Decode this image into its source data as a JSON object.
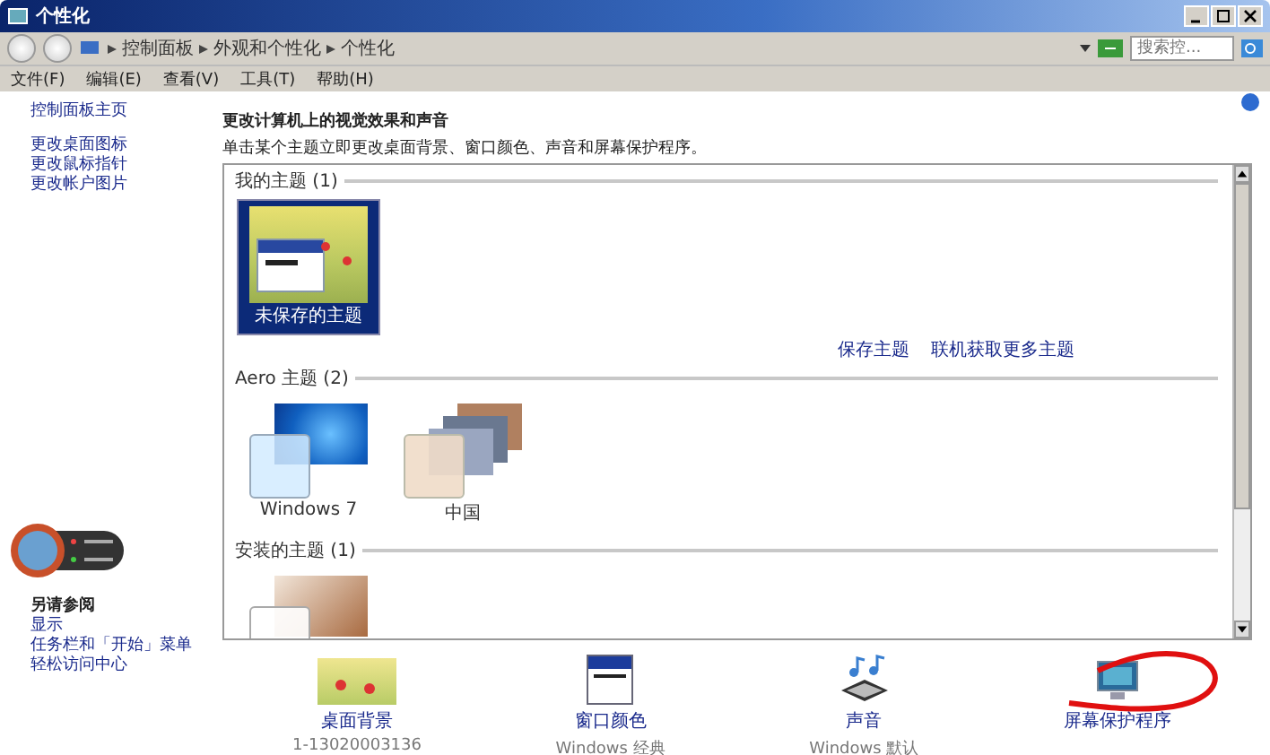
{
  "window": {
    "title": "个性化"
  },
  "address_bar": {
    "breadcrumb": [
      "控制面板",
      "外观和个性化",
      "个性化"
    ],
    "search_placeholder": "搜索控..."
  },
  "menu": [
    "文件(F)",
    "编辑(E)",
    "查看(V)",
    "工具(T)",
    "帮助(H)"
  ],
  "sidebar": {
    "home": "控制面板主页",
    "links": [
      "更改桌面图标",
      "更改鼠标指针",
      "更改帐户图片"
    ],
    "see_also": {
      "title": "另请参阅",
      "links": [
        "显示",
        "任务栏和「开始」菜单",
        "轻松访问中心"
      ]
    }
  },
  "main": {
    "heading": "更改计算机上的视觉效果和声音",
    "description": "单击某个主题立即更改桌面背景、窗口颜色、声音和屏幕保护程序。",
    "groups": [
      {
        "title": "我的主题 (1)",
        "themes": [
          {
            "kind": "unsaved",
            "name": "未保存的主题",
            "selected": true
          }
        ],
        "links": [
          "保存主题",
          "联机获取更多主题"
        ]
      },
      {
        "title": "Aero 主题 (2)",
        "themes": [
          {
            "kind": "win7",
            "name": "Windows 7",
            "selected": false
          },
          {
            "kind": "china",
            "name": "中国",
            "selected": false
          }
        ]
      },
      {
        "title": "安装的主题 (1)",
        "themes": [
          {
            "kind": "installed",
            "selected": false
          }
        ]
      }
    ]
  },
  "settings": [
    {
      "kind": "background",
      "label": "桌面背景",
      "sub": "1-13020003136"
    },
    {
      "kind": "color",
      "label": "窗口颜色",
      "sub": "Windows 经典"
    },
    {
      "kind": "sound",
      "label": "声音",
      "sub": "Windows 默认"
    },
    {
      "kind": "screensaver",
      "label": "屏幕保护程序"
    }
  ]
}
